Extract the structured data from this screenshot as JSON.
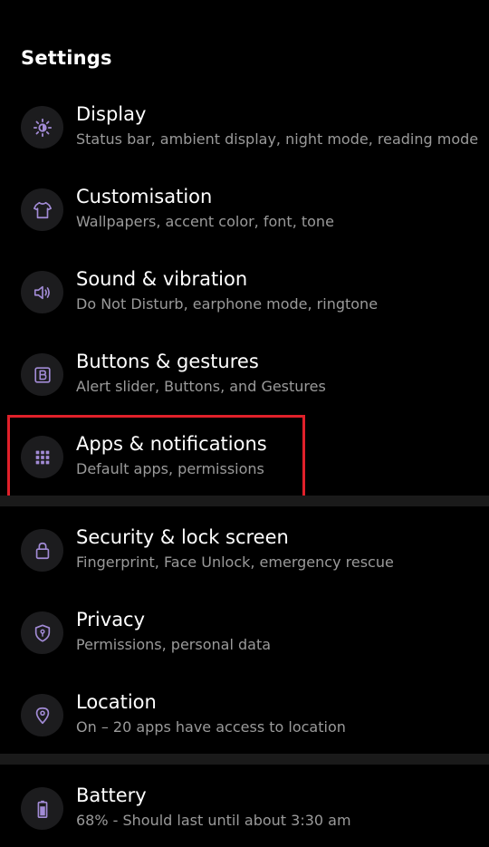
{
  "header": {
    "title": "Settings"
  },
  "colors": {
    "icon_accent": "#a28bd6",
    "highlight": "#e0202a"
  },
  "items": [
    {
      "icon": "brightness-icon",
      "title": "Display",
      "subtitle": "Status bar, ambient display, night mode, reading mode"
    },
    {
      "icon": "tshirt-icon",
      "title": "Customisation",
      "subtitle": "Wallpapers, accent color, font, tone"
    },
    {
      "icon": "speaker-icon",
      "title": "Sound & vibration",
      "subtitle": "Do Not Disturb, earphone mode, ringtone"
    },
    {
      "icon": "button-b-icon",
      "title": "Buttons & gestures",
      "subtitle": "Alert slider, Buttons, and Gestures"
    },
    {
      "icon": "apps-grid-icon",
      "title": "Apps & notifications",
      "subtitle": "Default apps, permissions"
    },
    {
      "icon": "lock-icon",
      "title": "Security & lock screen",
      "subtitle": "Fingerprint, Face Unlock, emergency rescue"
    },
    {
      "icon": "shield-key-icon",
      "title": "Privacy",
      "subtitle": "Permissions, personal data"
    },
    {
      "icon": "location-pin-icon",
      "title": "Location",
      "subtitle": "On – 20 apps have access to location"
    },
    {
      "icon": "battery-icon",
      "title": "Battery",
      "subtitle": "68% - Should last until about 3:30 am"
    }
  ]
}
